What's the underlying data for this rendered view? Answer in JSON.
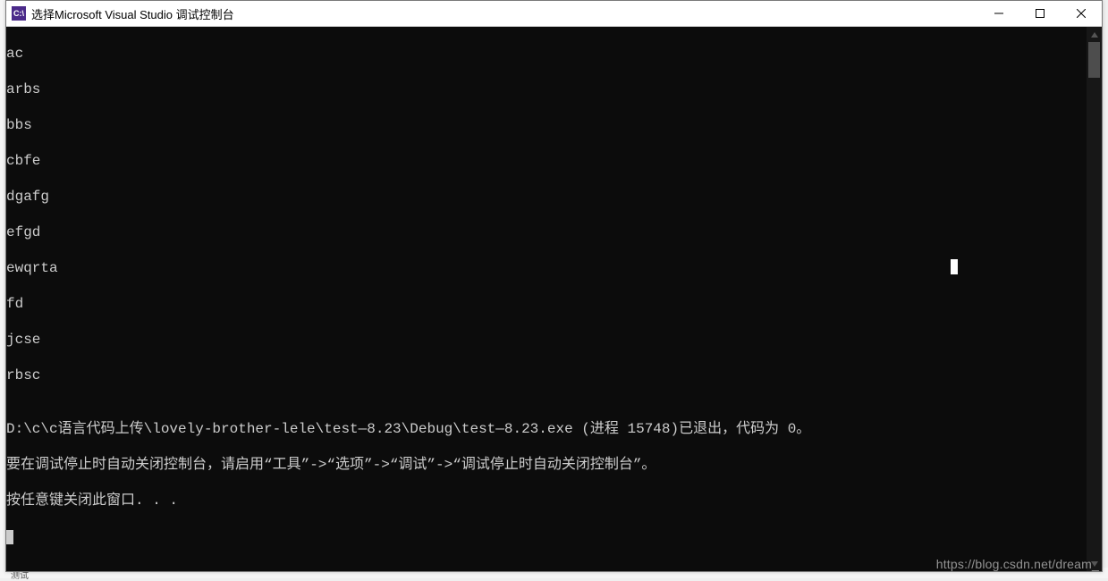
{
  "titlebar": {
    "icon_label": "C:\\",
    "title": "选择Microsoft Visual Studio 调试控制台"
  },
  "console": {
    "output_lines": [
      "ac",
      "arbs",
      "bbs",
      "cbfe",
      "dgafg",
      "efgd",
      "ewqrta",
      "fd",
      "jcse",
      "rbsc"
    ],
    "blank_line": "",
    "status_line": "D:\\c\\c语言代码上传\\lovely-brother-lele\\test—8.23\\Debug\\test—8.23.exe (进程 15748)已退出，代码为 0。",
    "hint_line": "要在调试停止时自动关闭控制台，请启用“工具”->“选项”->“调试”->“调试停止时自动关闭控制台”。",
    "press_any_key": "按任意键关闭此窗口. . ."
  },
  "background": {
    "bottom_label": "测试"
  },
  "watermark": {
    "text": "https://blog.csdn.net/dream_"
  }
}
